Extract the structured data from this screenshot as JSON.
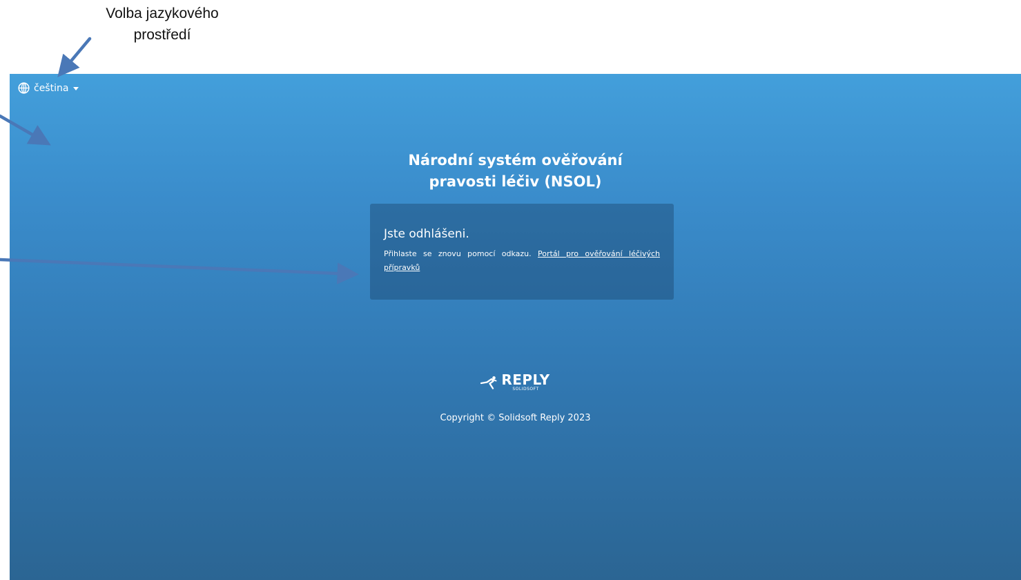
{
  "annotation": {
    "title_lines": [
      "Volba jazykového",
      "prostředí"
    ]
  },
  "header": {
    "language": {
      "label": "čeština",
      "icon": "globe-icon"
    }
  },
  "main": {
    "title_lines": [
      "Národní systém ověřování",
      "pravosti léčiv (NSOL)"
    ],
    "message": {
      "heading": "Jste odhlášeni.",
      "text": "Přihlaste se znovu pomocí odkazu.",
      "link_label": "Portál pro ověřování léčivých přípravků"
    }
  },
  "footer": {
    "logo": {
      "brand": "REPLY",
      "sub": "SOLIDSOFT",
      "icon": "reply-runner-icon"
    },
    "copyright": "Copyright © Solidsoft Reply 2023"
  },
  "colors": {
    "gradient_top": "#439fdb",
    "gradient_bottom": "#2b6593",
    "arrow": "#4a78b7",
    "text": "#ffffff"
  }
}
